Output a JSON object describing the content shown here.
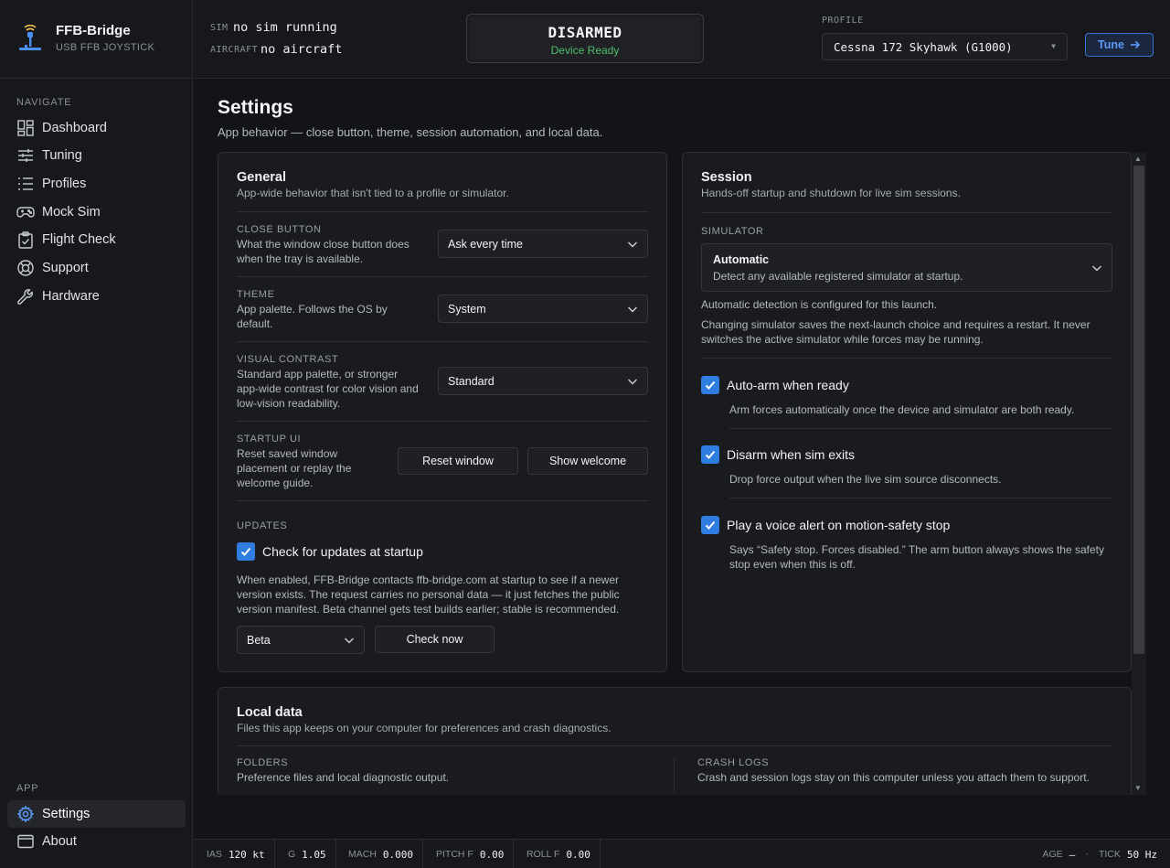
{
  "app": {
    "name": "FFB-Bridge",
    "subtitle": "USB FFB JOYSTICK"
  },
  "nav": {
    "heading": "NAVIGATE",
    "items": [
      {
        "label": "Dashboard",
        "icon": "dashboard-icon"
      },
      {
        "label": "Tuning",
        "icon": "sliders-icon"
      },
      {
        "label": "Profiles",
        "icon": "list-icon"
      },
      {
        "label": "Mock Sim",
        "icon": "gamepad-icon"
      },
      {
        "label": "Flight Check",
        "icon": "clipboard-icon"
      },
      {
        "label": "Support",
        "icon": "lifebuoy-icon"
      },
      {
        "label": "Hardware",
        "icon": "wrench-icon"
      }
    ],
    "app_heading": "APP",
    "app_items": [
      {
        "label": "Settings",
        "icon": "gear-icon",
        "active": true
      },
      {
        "label": "About",
        "icon": "window-icon"
      }
    ]
  },
  "topbar": {
    "sim_label": "SIM",
    "sim_value": "no sim running",
    "aircraft_label": "AIRCRAFT",
    "aircraft_value": "no aircraft",
    "status_title": "DISARMED",
    "status_sub": "Device Ready",
    "profile_label": "PROFILE",
    "profile_value": "Cessna 172 Skyhawk (G1000)",
    "tune_label": "Tune"
  },
  "page": {
    "title": "Settings",
    "subtitle": "App behavior — close button, theme, session automation, and local data."
  },
  "general": {
    "title": "General",
    "subtitle": "App-wide behavior that isn't tied to a profile or simulator.",
    "close_button": {
      "label": "CLOSE BUTTON",
      "desc": "What the window close button does when the tray is available.",
      "value": "Ask every time"
    },
    "theme": {
      "label": "THEME",
      "desc": "App palette. Follows the OS by default.",
      "value": "System"
    },
    "contrast": {
      "label": "VISUAL CONTRAST",
      "desc": "Standard app palette, or stronger app-wide contrast for color vision and low-vision readability.",
      "value": "Standard"
    },
    "startup": {
      "label": "STARTUP UI",
      "desc": "Reset saved window placement or replay the welcome guide.",
      "reset_label": "Reset window",
      "welcome_label": "Show welcome"
    },
    "updates": {
      "label": "UPDATES",
      "check_label": "Check for updates at startup",
      "checked": true,
      "help": "When enabled, FFB-Bridge contacts ffb-bridge.com at startup to see if a newer version exists. The request carries no personal data — it just fetches the public version manifest. Beta channel gets test builds earlier; stable is recommended.",
      "channel": "Beta",
      "check_now_label": "Check now"
    }
  },
  "session": {
    "title": "Session",
    "subtitle": "Hands-off startup and shutdown for live sim sessions.",
    "simulator_label": "SIMULATOR",
    "simulator_value": "Automatic",
    "simulator_desc": "Detect any available registered simulator at startup.",
    "note1": "Automatic detection is configured for this launch.",
    "note2": "Changing simulator saves the next-launch choice and requires a restart. It never switches the active simulator while forces may be running.",
    "auto_arm": {
      "label": "Auto-arm when ready",
      "help": "Arm forces automatically once the device and simulator are both ready.",
      "checked": true
    },
    "disarm": {
      "label": "Disarm when sim exits",
      "help": "Drop force output when the live sim source disconnects.",
      "checked": true
    },
    "voice": {
      "label": "Play a voice alert on motion-safety stop",
      "help": "Says “Safety stop. Forces disabled.” The arm button always shows the safety stop even when this is off.",
      "checked": true
    }
  },
  "local": {
    "title": "Local data",
    "subtitle": "Files this app keeps on your computer for preferences and crash diagnostics.",
    "folders_label": "FOLDERS",
    "folders_desc": "Preference files and local diagnostic output.",
    "crash_label": "CRASH LOGS",
    "crash_desc": "Crash and session logs stay on this computer unless you attach them to support."
  },
  "status": {
    "ias_k": "IAS",
    "ias_v": "120 kt",
    "g_k": "G",
    "g_v": "1.05",
    "mach_k": "MACH",
    "mach_v": "0.000",
    "pitch_k": "PITCH F",
    "pitch_v": "0.00",
    "roll_k": "ROLL F",
    "roll_v": "0.00",
    "age_k": "AGE",
    "age_v": "—",
    "sep": "·",
    "tick_k": "TICK",
    "tick_v": "50 Hz"
  },
  "colors": {
    "accent": "#2f7de1",
    "ready": "#4fbf6a",
    "background": "#131417",
    "card": "#1a1b1f"
  }
}
